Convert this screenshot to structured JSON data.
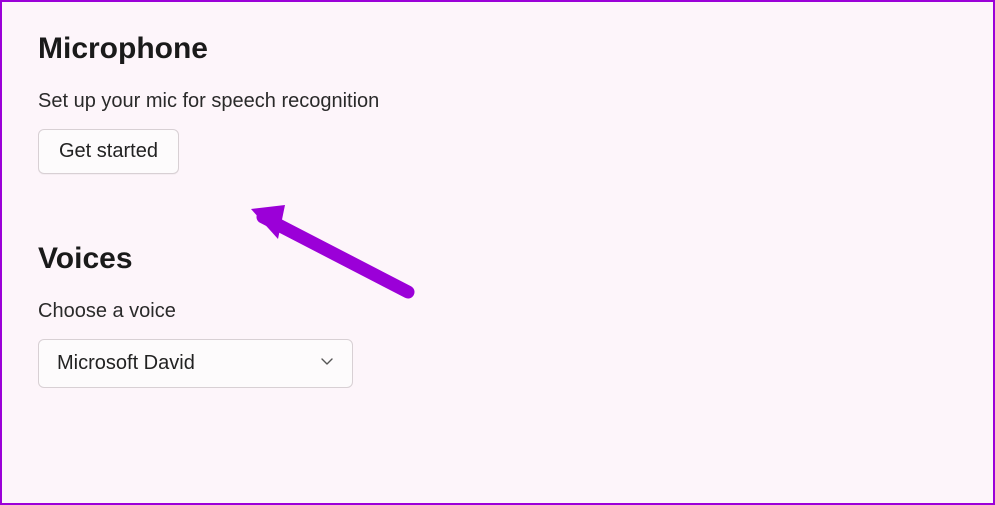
{
  "microphone": {
    "heading": "Microphone",
    "subtext": "Set up your mic for speech recognition",
    "button_label": "Get started"
  },
  "voices": {
    "heading": "Voices",
    "label": "Choose a voice",
    "selected": "Microsoft David"
  },
  "annotation": {
    "arrow_color": "#9b00d8"
  }
}
